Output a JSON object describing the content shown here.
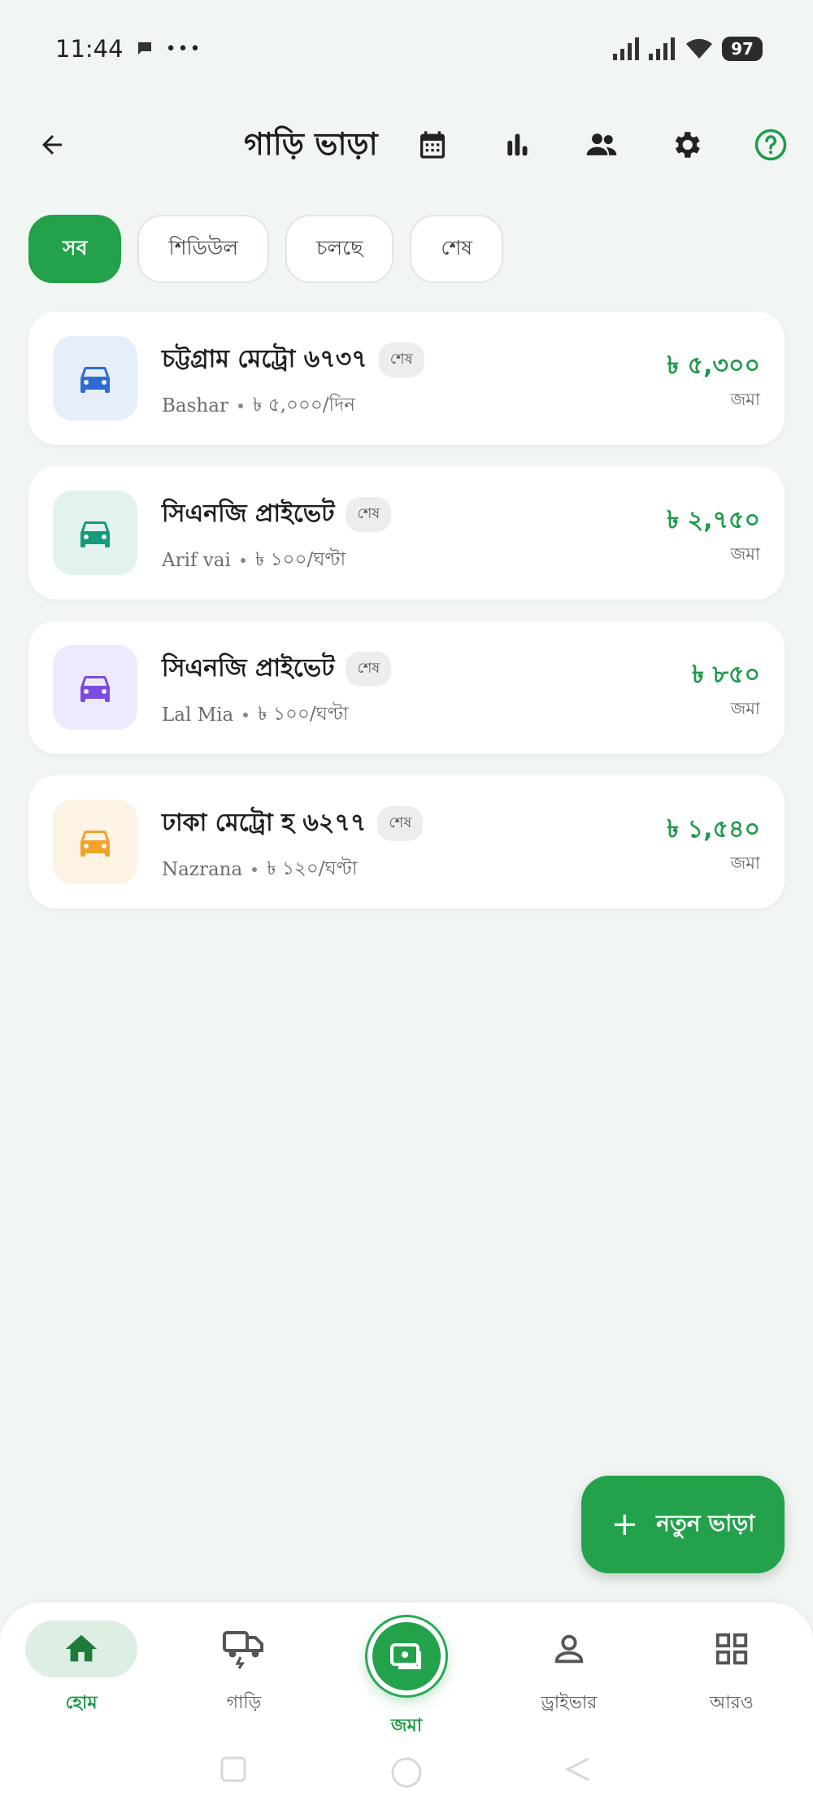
{
  "status_bar": {
    "time": "11:44",
    "extra": "•••",
    "battery": "97"
  },
  "header": {
    "title": "গাড়ি ভাড়া"
  },
  "filters": [
    {
      "label": "সব",
      "active": true
    },
    {
      "label": "শিডিউল",
      "active": false
    },
    {
      "label": "চলছে",
      "active": false
    },
    {
      "label": "শেষ",
      "active": false
    }
  ],
  "rentals": [
    {
      "name": "চট্টগ্রাম মেট্রো ৬৭৩৭",
      "status": "শেষ",
      "driver": "Bashar",
      "rate": "৳ ৫,০০০/দিন",
      "amount": "৳ ৫,৩০০",
      "amount_label": "জমা",
      "icon": "car-icon",
      "icon_color": "#2f6bd1",
      "icon_bg": "#e6eef9"
    },
    {
      "name": "সিএনজি প্রাইভেট",
      "status": "শেষ",
      "driver": "Arif vai",
      "rate": "৳ ১০০/ঘণ্টা",
      "amount": "৳ ২,৭৫০",
      "amount_label": "জমা",
      "icon": "car-icon",
      "icon_color": "#159a7c",
      "icon_bg": "#e2f3ee"
    },
    {
      "name": "সিএনজি প্রাইভেট",
      "status": "শেষ",
      "driver": "Lal Mia",
      "rate": "৳ ১০০/ঘণ্টা",
      "amount": "৳ ৮৫০",
      "amount_label": "জমা",
      "icon": "car-icon",
      "icon_color": "#7a4de0",
      "icon_bg": "#eeeafd"
    },
    {
      "name": "ঢাকা মেট্রো হ ৬২৭৭",
      "status": "শেষ",
      "driver": "Nazrana",
      "rate": "৳ ১২০/ঘণ্টা",
      "amount": "৳ ১,৫৪০",
      "amount_label": "জমা",
      "icon": "car-icon",
      "icon_color": "#f0a32a",
      "icon_bg": "#fdf3e4"
    }
  ],
  "fab": {
    "label": "নতুন ভাড়া"
  },
  "bottom_nav": {
    "home": "হোম",
    "cars": "গাড়ি",
    "deposit": "জমা",
    "drivers": "ড্রাইভার",
    "more": "আরও"
  },
  "colors": {
    "accent": "#23a14b",
    "amount": "#1f9a4a"
  }
}
